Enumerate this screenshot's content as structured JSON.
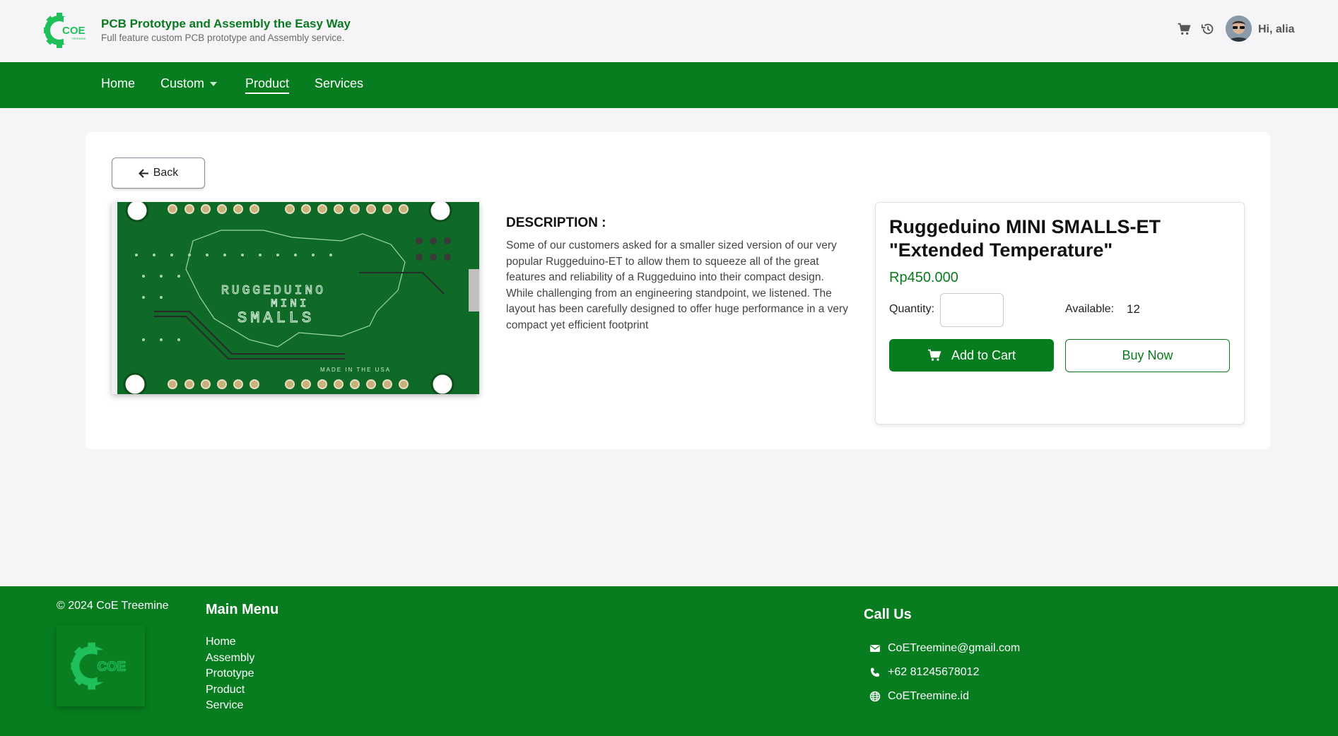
{
  "header": {
    "title": "PCB Prototype and Assembly the Easy Way",
    "subtitle": "Full feature custom PCB prototype and Assembly service.",
    "logo_text": "COE",
    "icons": [
      "cart-icon",
      "history-icon"
    ],
    "greeting": "Hi, alia"
  },
  "nav": {
    "items": [
      {
        "label": "Home"
      },
      {
        "label": "Custom"
      },
      {
        "label": "Product"
      },
      {
        "label": "Services"
      }
    ],
    "active": "Product"
  },
  "main": {
    "back_label": "Back",
    "description_title": "DESCRIPTION :",
    "description": "Some of our customers asked for a smaller sized version of our very popular Ruggeduino-ET to allow them to squeeze all of the great features and reliability of a Ruggeduino into their compact design. While challenging from an engineering standpoint, we listened. The layout has been carefully designed to offer huge performance in a very compact yet efficient footprint",
    "image_silkscreen": [
      "RUGGEDUINO",
      "MINI",
      "SMALLS",
      "MADE IN THE USA"
    ]
  },
  "product": {
    "name": "Ruggeduino MINI SMALLS-ET \"Extended Temperature\"",
    "price": "Rp450.000",
    "quantity_label": "Quantity:",
    "quantity_value": "",
    "available_label": "Available:",
    "available_value": "12",
    "add_to_cart_label": "Add to Cart",
    "buy_now_label": "Buy Now"
  },
  "footer": {
    "copyright": "© 2024 CoE Treemine",
    "main_menu_title": "Main Menu",
    "menu": [
      "Home",
      "Assembly",
      "Prototype",
      "Product",
      "Service"
    ],
    "call_title": "Call Us",
    "email": "CoETreemine@gmail.com",
    "phone": "+62 81245678012",
    "website": "CoETreemine.id"
  },
  "colors": {
    "brand_green": "#077d1f",
    "logo_green": "#1fbf5a",
    "page_bg": "#f5f4f7"
  }
}
